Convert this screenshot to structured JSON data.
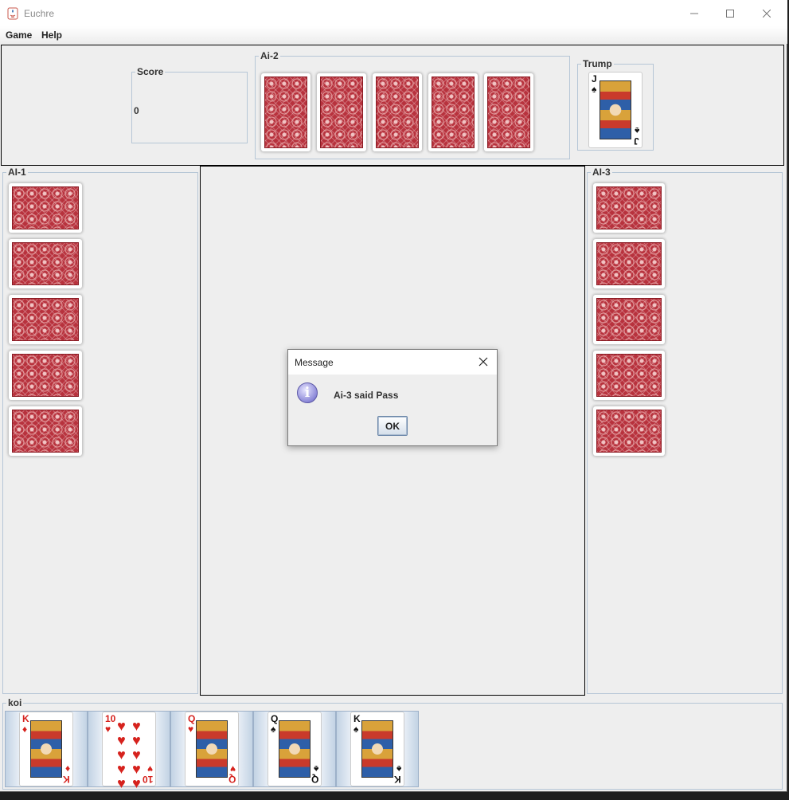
{
  "window": {
    "title": "Euchre"
  },
  "menu": {
    "game": "Game",
    "help": "Help"
  },
  "score": {
    "legend": "Score",
    "value": "0"
  },
  "ai2": {
    "legend": "Ai-2",
    "card_count": 5
  },
  "trump": {
    "legend": "Trump",
    "rank": "J",
    "suit": "♠"
  },
  "ai1": {
    "legend": "AI-1",
    "card_count": 5
  },
  "ai3": {
    "legend": "AI-3",
    "card_count": 5
  },
  "player": {
    "legend": "koi",
    "cards": [
      {
        "rank": "K",
        "suit": "♦",
        "color": "red"
      },
      {
        "rank": "10",
        "suit": "♥",
        "color": "red"
      },
      {
        "rank": "Q",
        "suit": "♥",
        "color": "red"
      },
      {
        "rank": "Q",
        "suit": "♠",
        "color": "black"
      },
      {
        "rank": "K",
        "suit": "♠",
        "color": "black"
      }
    ]
  },
  "dialog": {
    "title": "Message",
    "message": "Ai-3 said Pass",
    "ok_label": "OK"
  }
}
